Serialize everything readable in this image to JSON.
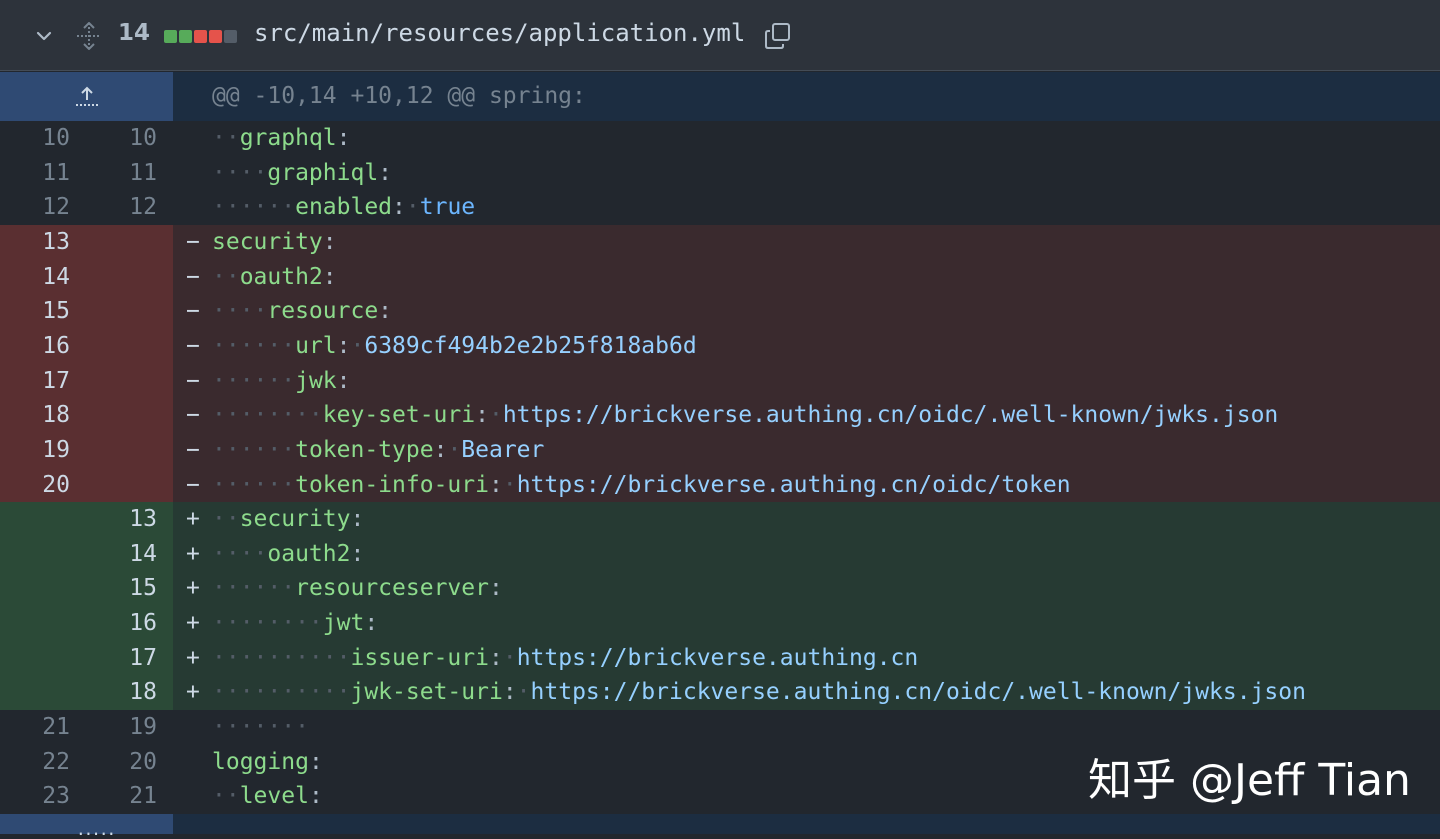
{
  "header": {
    "changes_count": "14",
    "file_path": "src/main/resources/application.yml",
    "diffstat": [
      "#57ab5a",
      "#57ab5a",
      "#e5534b",
      "#e5534b",
      "#545d68"
    ]
  },
  "hunk": {
    "text": "@@ -10,14 +10,12 @@ spring:"
  },
  "rows": [
    {
      "type": "ctx",
      "old": "10",
      "new": "10",
      "indent": "··",
      "key": "graphql",
      "sep": ":",
      "value": ""
    },
    {
      "type": "ctx",
      "old": "11",
      "new": "11",
      "indent": "····",
      "key": "graphiql",
      "sep": ":",
      "value": ""
    },
    {
      "type": "ctx",
      "old": "12",
      "new": "12",
      "indent": "······",
      "key": "enabled",
      "sep": ":",
      "value": "true"
    },
    {
      "type": "del",
      "old": "13",
      "new": "",
      "indent": "",
      "key": "security",
      "sep": ":",
      "value": ""
    },
    {
      "type": "del",
      "old": "14",
      "new": "",
      "indent": "··",
      "key": "oauth2",
      "sep": ":",
      "value": ""
    },
    {
      "type": "del",
      "old": "15",
      "new": "",
      "indent": "····",
      "key": "resource",
      "sep": ":",
      "value": ""
    },
    {
      "type": "del",
      "old": "16",
      "new": "",
      "indent": "······",
      "key": "url",
      "sep": ":",
      "value": "6389cf494b2e2b25f818ab6d"
    },
    {
      "type": "del",
      "old": "17",
      "new": "",
      "indent": "······",
      "key": "jwk",
      "sep": ":",
      "value": ""
    },
    {
      "type": "del",
      "old": "18",
      "new": "",
      "indent": "········",
      "key": "key-set-uri",
      "sep": ":",
      "value": "https://brickverse.authing.cn/oidc/.well-known/jwks.json"
    },
    {
      "type": "del",
      "old": "19",
      "new": "",
      "indent": "······",
      "key": "token-type",
      "sep": ":",
      "value": "Bearer"
    },
    {
      "type": "del",
      "old": "20",
      "new": "",
      "indent": "······",
      "key": "token-info-uri",
      "sep": ":",
      "value": "https://brickverse.authing.cn/oidc/token"
    },
    {
      "type": "add",
      "old": "",
      "new": "13",
      "indent": "··",
      "key": "security",
      "sep": ":",
      "value": ""
    },
    {
      "type": "add",
      "old": "",
      "new": "14",
      "indent": "····",
      "key": "oauth2",
      "sep": ":",
      "value": ""
    },
    {
      "type": "add",
      "old": "",
      "new": "15",
      "indent": "······",
      "key": "resourceserver",
      "sep": ":",
      "value": ""
    },
    {
      "type": "add",
      "old": "",
      "new": "16",
      "indent": "········",
      "key": "jwt",
      "sep": ":",
      "value": ""
    },
    {
      "type": "add",
      "old": "",
      "new": "17",
      "indent": "··········",
      "key": "issuer-uri",
      "sep": ":",
      "value": "https://brickverse.authing.cn"
    },
    {
      "type": "add",
      "old": "",
      "new": "18",
      "indent": "··········",
      "key": "jwk-set-uri",
      "sep": ":",
      "value": "https://brickverse.authing.cn/oidc/.well-known/jwks.json"
    },
    {
      "type": "ctx",
      "old": "21",
      "new": "19",
      "indent": "·······",
      "key": "",
      "sep": "",
      "value": ""
    },
    {
      "type": "ctx",
      "old": "22",
      "new": "20",
      "indent": "",
      "key": "logging",
      "sep": ":",
      "value": ""
    },
    {
      "type": "ctx",
      "old": "23",
      "new": "21",
      "indent": "··",
      "key": "level",
      "sep": ":",
      "value": ""
    }
  ],
  "markers": {
    "del": "−",
    "add": "+",
    "ctx": ""
  },
  "footer": {
    "dots": "....."
  },
  "watermark": "知乎 @Jeff Tian"
}
